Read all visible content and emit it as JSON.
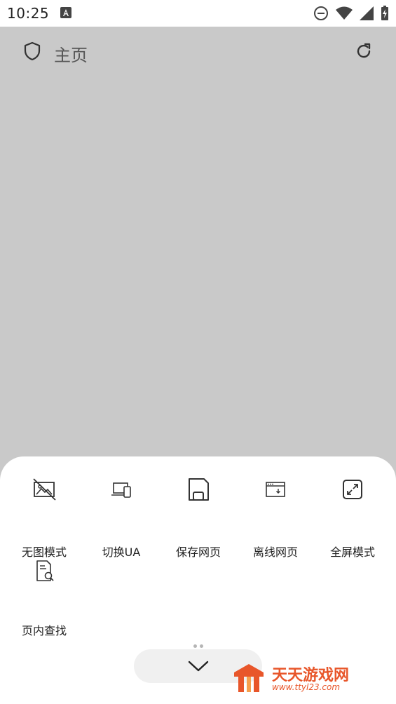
{
  "status_bar": {
    "time": "10:25",
    "icons": [
      "a-icon",
      "do-not-disturb-icon",
      "wifi-icon",
      "signal-icon",
      "battery-charging-icon"
    ]
  },
  "header": {
    "title": "主页",
    "left_icon": "shield-icon",
    "right_icon": "refresh-icon"
  },
  "menu": {
    "items": [
      {
        "label": "无图模式",
        "icon": "no-image-icon"
      },
      {
        "label": "切换UA",
        "icon": "switch-ua-icon"
      },
      {
        "label": "保存网页",
        "icon": "save-page-icon"
      },
      {
        "label": "离线网页",
        "icon": "offline-page-icon"
      },
      {
        "label": "全屏模式",
        "icon": "fullscreen-icon"
      },
      {
        "label": "页内查找",
        "icon": "find-in-page-icon"
      }
    ],
    "page_indicator": {
      "pages": 2,
      "current": 1
    },
    "collapse_icon": "chevron-down-icon"
  },
  "watermark": {
    "text": "天天游戏网",
    "url": "www.ttyl23.com"
  },
  "colors": {
    "page_background": "#c9c9c9",
    "sheet_background": "#ffffff",
    "icon": "#333333",
    "watermark": "#e8562a"
  }
}
